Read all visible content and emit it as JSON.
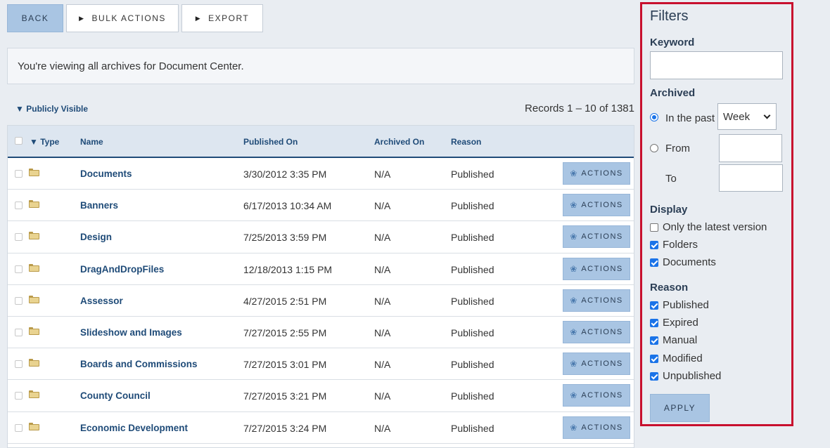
{
  "toolbar": {
    "back_label": "BACK",
    "bulk_actions_label": "BULK ACTIONS",
    "export_label": "EXPORT"
  },
  "info": {
    "message": "You're viewing all archives for Document Center."
  },
  "visibility": {
    "label": "Publicly Visible"
  },
  "records": {
    "text": "Records 1 – 10 of 1381"
  },
  "table": {
    "headers": {
      "type": "Type",
      "name": "Name",
      "published_on": "Published On",
      "archived_on": "Archived On",
      "reason": "Reason"
    },
    "action_label": "ACTIONS",
    "rows": [
      {
        "icon": "folder-icon",
        "name": "Documents",
        "published": "3/30/2012 3:35 PM",
        "archived": "N/A",
        "reason": "Published"
      },
      {
        "icon": "folder-icon",
        "name": "Banners",
        "published": "6/17/2013 10:34 AM",
        "archived": "N/A",
        "reason": "Published"
      },
      {
        "icon": "folder-icon",
        "name": "Design",
        "published": "7/25/2013 3:59 PM",
        "archived": "N/A",
        "reason": "Published"
      },
      {
        "icon": "folder-icon",
        "name": "DragAndDropFiles",
        "published": "12/18/2013 1:15 PM",
        "archived": "N/A",
        "reason": "Published"
      },
      {
        "icon": "folder-icon",
        "name": "Assessor",
        "published": "4/27/2015 2:51 PM",
        "archived": "N/A",
        "reason": "Published"
      },
      {
        "icon": "folder-icon",
        "name": "Slideshow and Images",
        "published": "7/27/2015 2:55 PM",
        "archived": "N/A",
        "reason": "Published"
      },
      {
        "icon": "folder-icon",
        "name": "Boards and Commissions",
        "published": "7/27/2015 3:01 PM",
        "archived": "N/A",
        "reason": "Published"
      },
      {
        "icon": "folder-icon",
        "name": "County Council",
        "published": "7/27/2015 3:21 PM",
        "archived": "N/A",
        "reason": "Published"
      },
      {
        "icon": "folder-icon",
        "name": "Economic Development",
        "published": "7/27/2015 3:24 PM",
        "archived": "N/A",
        "reason": "Published"
      }
    ]
  },
  "filters": {
    "title": "Filters",
    "keyword_label": "Keyword",
    "keyword_value": "",
    "archived_label": "Archived",
    "in_the_past_label": "In the past",
    "period_selected": "Week",
    "from_label": "From",
    "to_label": "To",
    "from_value": "",
    "to_value": "",
    "display_label": "Display",
    "display_options": [
      {
        "label": "Only the latest version",
        "checked": false
      },
      {
        "label": "Folders",
        "checked": true
      },
      {
        "label": "Documents",
        "checked": true
      }
    ],
    "reason_label": "Reason",
    "reason_options": [
      {
        "label": "Published",
        "checked": true
      },
      {
        "label": "Expired",
        "checked": true
      },
      {
        "label": "Manual",
        "checked": true
      },
      {
        "label": "Modified",
        "checked": true
      },
      {
        "label": "Unpublished",
        "checked": true
      }
    ],
    "apply_label": "APPLY",
    "archived_mode": "in_the_past"
  },
  "colors": {
    "accent_button": "#a9c5e3",
    "link": "#1f4b78",
    "highlight_border": "#c8102e",
    "checkbox": "#1a73e8"
  }
}
